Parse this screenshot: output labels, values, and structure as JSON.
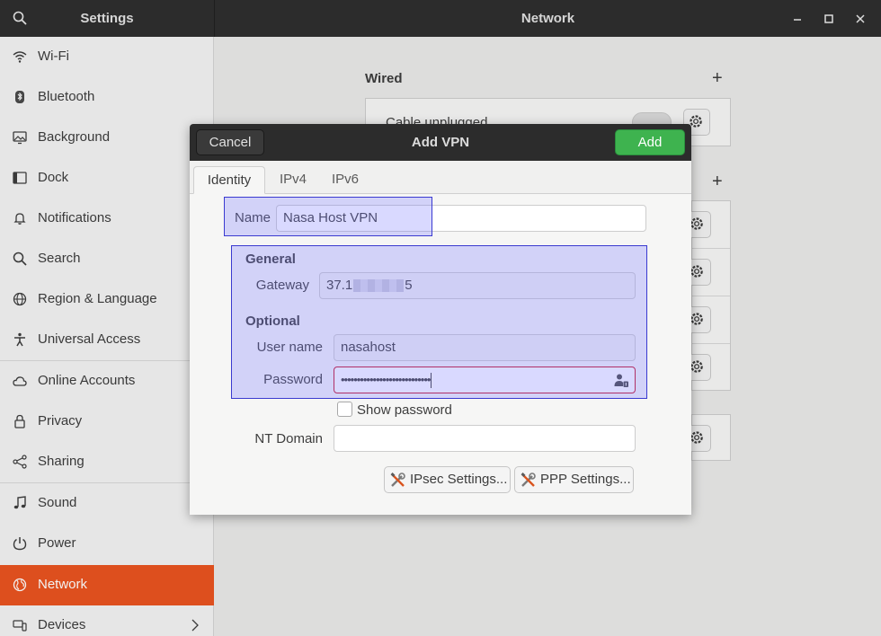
{
  "window": {
    "left_title": "Settings",
    "title": "Network"
  },
  "sidebar": {
    "items": [
      {
        "label": "Wi-Fi",
        "icon": "wifi-icon"
      },
      {
        "label": "Bluetooth",
        "icon": "bluetooth-icon"
      },
      {
        "label": "Background",
        "icon": "background-icon"
      },
      {
        "label": "Dock",
        "icon": "dock-icon"
      },
      {
        "label": "Notifications",
        "icon": "bell-icon"
      },
      {
        "label": "Search",
        "icon": "search-icon"
      },
      {
        "label": "Region & Language",
        "icon": "globe-icon"
      },
      {
        "label": "Universal Access",
        "icon": "accessibility-icon"
      },
      {
        "label": "Online Accounts",
        "icon": "cloud-icon"
      },
      {
        "label": "Privacy",
        "icon": "lock-icon"
      },
      {
        "label": "Sharing",
        "icon": "share-icon"
      },
      {
        "label": "Sound",
        "icon": "music-note-icon"
      },
      {
        "label": "Power",
        "icon": "power-icon"
      },
      {
        "label": "Network",
        "icon": "network-globe-icon",
        "active": true
      },
      {
        "label": "Devices",
        "icon": "devices-icon"
      }
    ]
  },
  "main": {
    "wired_title": "Wired",
    "cable_status": "Cable unplugged"
  },
  "dialog": {
    "title": "Add VPN",
    "cancel_label": "Cancel",
    "add_label": "Add",
    "tabs": [
      {
        "label": "Identity",
        "active": true
      },
      {
        "label": "IPv4"
      },
      {
        "label": "IPv6"
      }
    ],
    "name_label": "Name",
    "name_value": "Nasa Host VPN",
    "general_title": "General",
    "gateway_label": "Gateway",
    "gateway_prefix": "37.1",
    "gateway_suffix": "5",
    "optional_title": "Optional",
    "username_label": "User name",
    "username_value": "nasahost",
    "password_label": "Password",
    "password_value": "••••••••••••••••••••••••••••",
    "show_password_label": "Show password",
    "nt_domain_label": "NT Domain",
    "nt_domain_value": "",
    "ipsec_label": "IPsec Settings...",
    "ppp_label": "PPP Settings..."
  },
  "colors": {
    "accent": "#e95420",
    "add_button": "#3eb34f",
    "titlebar": "#2c2c2c",
    "highlight": "#3a3ad0"
  }
}
